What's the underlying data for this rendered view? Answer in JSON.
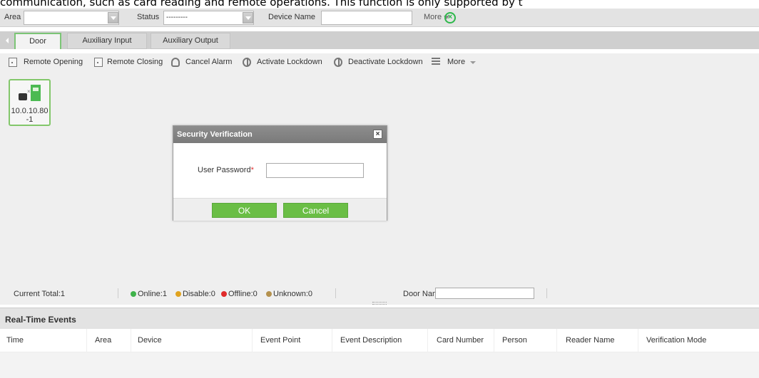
{
  "doc_text": "communication, such as card reading and remote operations. This function is only supported by t",
  "filters": {
    "area_label": "Area",
    "area_value": "",
    "status_label": "Status",
    "status_value": "---------",
    "device_name_label": "Device Name",
    "device_name_value": "",
    "more_label": "More"
  },
  "tabs": [
    {
      "label": "Door",
      "active": true
    },
    {
      "label": "Auxiliary Input",
      "active": false
    },
    {
      "label": "Auxiliary Output",
      "active": false
    }
  ],
  "toolbar": {
    "remote_opening": "Remote Opening",
    "remote_closing": "Remote Closing",
    "cancel_alarm": "Cancel Alarm",
    "activate_lockdown": "Activate Lockdown",
    "deactivate_lockdown": "Deactivate Lockdown",
    "more": "More"
  },
  "doors": [
    {
      "label": "10.0.10.80-1"
    }
  ],
  "dialog": {
    "title": "Security Verification",
    "close": "×",
    "password_label": "User Password",
    "required_mark": "*",
    "password_value": "",
    "ok": "OK",
    "cancel": "Cancel"
  },
  "status": {
    "current_total": "Current Total:1",
    "online": "Online:1",
    "disable": "Disable:0",
    "offline": "Offline:0",
    "unknown": "Unknown:0",
    "door_name_label": "Door Name",
    "door_name_value": ""
  },
  "status_colors": {
    "online": "#3fb24a",
    "disable": "#e0a31f",
    "offline": "#e02a2a",
    "unknown": "#b4914e"
  },
  "realtime": {
    "title": "Real-Time Events",
    "columns": [
      "Time",
      "Area",
      "Device",
      "Event Point",
      "Event Description",
      "Card Number",
      "Person",
      "Reader Name",
      "Verification Mode"
    ]
  },
  "accent_color": "#6abe45"
}
